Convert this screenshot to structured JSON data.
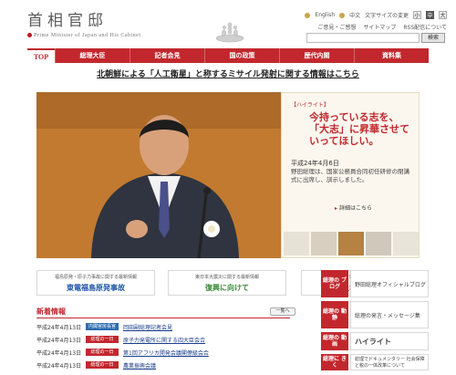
{
  "header": {
    "title": "首相官邸",
    "subtitle": "Prime Minister of Japan and His Cabinet",
    "utility": {
      "english": "English",
      "chinese": "中文",
      "font_size": "文字サイズの変更",
      "font_small": "小",
      "font_medium": "中",
      "font_large": "大"
    },
    "links": [
      "ご意見・ご感想",
      "サイトマップ",
      "RSS配信について"
    ],
    "search_placeholder": "",
    "search_button": "検索"
  },
  "nav": {
    "top": "TOP",
    "items": [
      "総理大臣",
      "記者会見",
      "国の政策",
      "歴代内閣",
      "資料集"
    ]
  },
  "alert": {
    "text": "北朝鮮による「人工衛星」と称するミサイル発射に関する情報はこちら"
  },
  "hero": {
    "tag": "【ハイライト】",
    "headline": "今持っている志を、「大志」に昇華させていってほしい。",
    "date": "平成24年4月6日",
    "description": "野田総理は、国家公務員合同初任研修の閉講式に出席し、訓示しました。",
    "more": "詳細はこちら"
  },
  "banners": [
    {
      "small": "福島原発・原子力事故に関する最新情報",
      "main": "東電福島原発事故",
      "color": "#1f56a8"
    },
    {
      "small": "東日本大震災に関する最新情報",
      "main": "復興に向けて",
      "color": "#3a8a3a"
    },
    {
      "small": "首相官邸東北支援ページ",
      "main": "被災地への支援",
      "color": "#c2272d"
    }
  ],
  "news": {
    "title": "新着情報",
    "list_button": "一覧へ",
    "rows": [
      {
        "date": "平成24年4月13日",
        "category": "内閣官房長官",
        "text": "岡田副総理記者会見",
        "color": "#2b6cb0"
      },
      {
        "date": "平成24年4月13日",
        "category": "総理の一日",
        "text": "原子力発電所に関する四大臣会合",
        "color": "#c2272d"
      },
      {
        "date": "平成24年4月13日",
        "category": "総理の一日",
        "text": "第1回アフリカ開発会議閣僚級会合",
        "color": "#c2272d"
      },
      {
        "date": "平成24年4月13日",
        "category": "総理の一日",
        "text": "農業振興会議",
        "color": "#c2272d"
      }
    ]
  },
  "right": {
    "blocks": [
      {
        "label": "総理の\nブログ",
        "body": "野田総理オフィシャルブログ"
      },
      {
        "label": "総理の\n動静",
        "body": "総理の発言・メッセージ集"
      },
      {
        "label": "総理の\n動画",
        "body": "ハイライト"
      },
      {
        "label": "総理に\nきく",
        "body": "総理でドキュメンタリー 社会保障と税の一体改革について"
      }
    ]
  }
}
